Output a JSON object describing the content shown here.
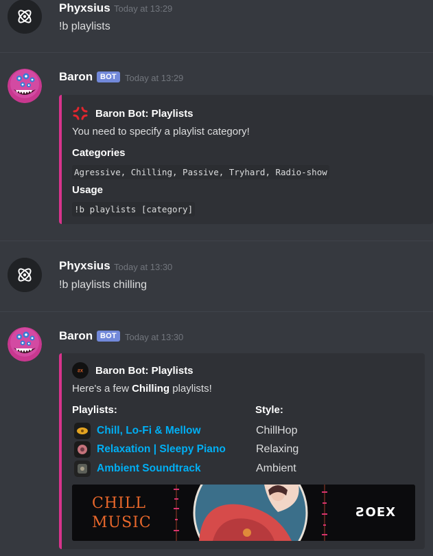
{
  "messages": [
    {
      "author": "Phyxsius",
      "time": "Today at 13:29",
      "text": "!b playlists"
    },
    {
      "author": "Baron",
      "bot_tag": "BOT",
      "time": "Today at 13:29",
      "embed": {
        "author": "Baron Bot: Playlists",
        "description": "You need to specify a playlist category!",
        "field1_name": "Categories",
        "field1_value": "Agressive, Chilling, Passive, Tryhard, Radio-show",
        "field2_name": "Usage",
        "field2_value": "!b playlists [category]"
      }
    },
    {
      "author": "Phyxsius",
      "time": "Today at 13:30",
      "text": "!b playlists chilling"
    },
    {
      "author": "Baron",
      "bot_tag": "BOT",
      "time": "Today at 13:30",
      "embed": {
        "author": "Baron Bot: Playlists",
        "description_prefix": "Here's a few ",
        "description_bold": "Chilling",
        "description_suffix": " playlists!",
        "playlists_header": "Playlists:",
        "style_header": "Style:",
        "playlists": [
          {
            "name": "Chill, Lo-Fi & Mellow",
            "style": "ChillHop"
          },
          {
            "name": "Relaxation | Sleepy Piano",
            "style": "Relaxing"
          },
          {
            "name": "Ambient Soundtrack",
            "style": "Ambient"
          }
        ],
        "banner_line1": "CHILL",
        "banner_line2": "MUSIC",
        "banner_brand": "ƧOEX"
      }
    }
  ],
  "colors": {
    "embed_accent": "#d8338c",
    "link": "#00aff4",
    "bot_tag": "#7289da"
  }
}
